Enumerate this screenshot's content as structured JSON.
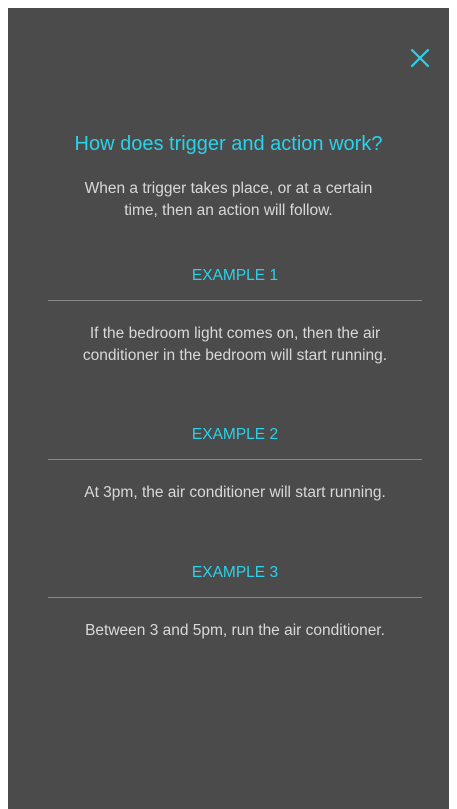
{
  "dialog": {
    "close_icon": "close-icon",
    "accent_color": "#2ad2ea",
    "background_color": "#4b4b4b",
    "title": "How does trigger and action work?",
    "intro": "When a trigger takes place, or at a certain time, then an action will follow."
  },
  "examples": [
    {
      "heading": "EXAMPLE 1",
      "text": "If the bedroom light comes on, then the air conditioner in the bedroom will start running."
    },
    {
      "heading": "EXAMPLE 2",
      "text": "At 3pm, the air conditioner will start running."
    },
    {
      "heading": "EXAMPLE 3",
      "text": "Between 3 and 5pm, run the air conditioner."
    }
  ]
}
